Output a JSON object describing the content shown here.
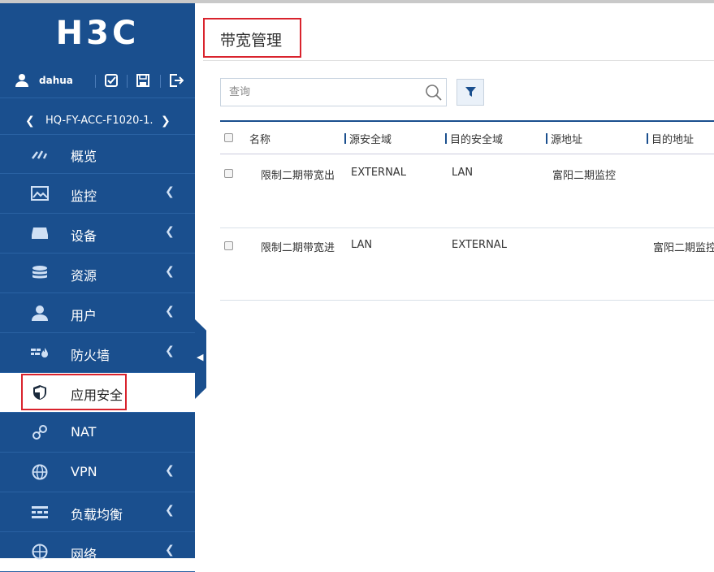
{
  "brand": {
    "logo_text": "H3C"
  },
  "user": {
    "name": "dahua"
  },
  "device": {
    "name": "HQ-FY-ACC-F1020-1."
  },
  "menu": [
    {
      "label": "概览",
      "icon": "gauge-icon",
      "has_children": false
    },
    {
      "label": "监控",
      "icon": "monitor-chart-icon",
      "has_children": true
    },
    {
      "label": "设备",
      "icon": "device-icon",
      "has_children": true
    },
    {
      "label": "资源",
      "icon": "database-icon",
      "has_children": true
    },
    {
      "label": "用户",
      "icon": "user-icon",
      "has_children": true
    },
    {
      "label": "防火墙",
      "icon": "firewall-icon",
      "has_children": true
    },
    {
      "label": "应用安全",
      "icon": "shield-icon",
      "has_children": false,
      "active": true
    },
    {
      "label": "NAT",
      "icon": "nat-icon",
      "has_children": false
    },
    {
      "label": "VPN",
      "icon": "globe-icon",
      "has_children": true
    },
    {
      "label": "负载均衡",
      "icon": "load-balance-icon",
      "has_children": true
    },
    {
      "label": "网络",
      "icon": "network-icon",
      "has_children": true
    }
  ],
  "page": {
    "title": "带宽管理"
  },
  "search": {
    "placeholder": "查询",
    "value": ""
  },
  "table": {
    "columns": [
      "名称",
      "源安全域",
      "目的安全域",
      "源地址",
      "目的地址"
    ],
    "rows": [
      {
        "name": "限制二期带宽出",
        "src_zone": "EXTERNAL",
        "dst_zone": "LAN",
        "src_addr": "富阳二期监控",
        "dst_addr": ""
      },
      {
        "name": "限制二期带宽进",
        "src_zone": "LAN",
        "dst_zone": "EXTERNAL",
        "src_addr": "",
        "dst_addr": "富阳二期监控"
      }
    ]
  },
  "colors": {
    "sidebar": "#1a4f8e",
    "highlight": "#d9232d"
  }
}
